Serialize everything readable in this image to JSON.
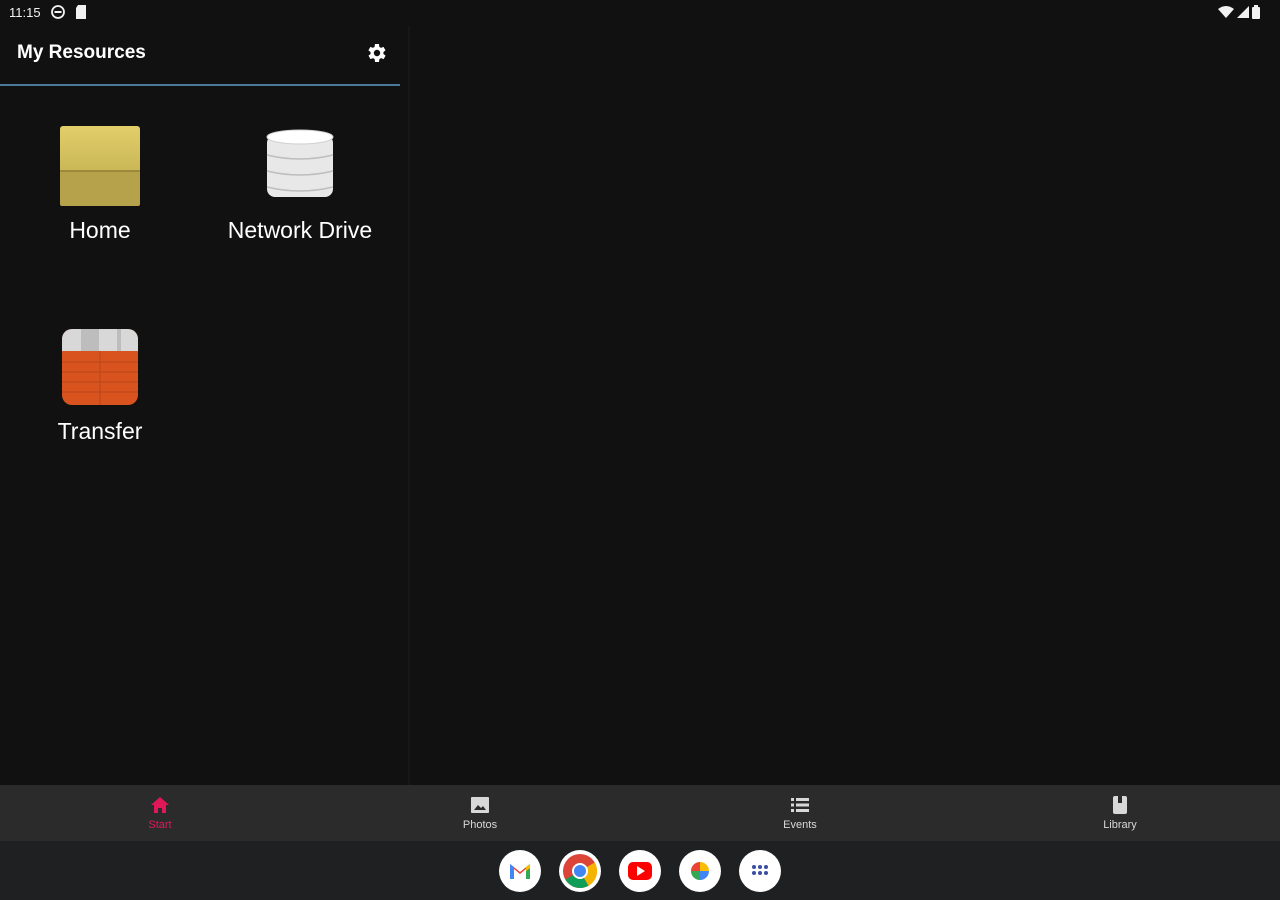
{
  "status_bar": {
    "time": "11:15"
  },
  "panel": {
    "title": "My Resources"
  },
  "resources": [
    {
      "label": "Home",
      "icon": "folder-icon"
    },
    {
      "label": "Network Drive",
      "icon": "database-icon"
    },
    {
      "label": "Transfer",
      "icon": "transfer-box-icon"
    }
  ],
  "bottom_nav": {
    "items": [
      {
        "label": "Start",
        "icon": "home-icon",
        "active": true
      },
      {
        "label": "Photos",
        "icon": "image-icon",
        "active": false
      },
      {
        "label": "Events",
        "icon": "list-icon",
        "active": false
      },
      {
        "label": "Library",
        "icon": "book-icon",
        "active": false
      }
    ]
  },
  "dock": {
    "apps": [
      "gmail-icon",
      "chrome-icon",
      "youtube-icon",
      "photos-icon",
      "app-drawer-icon"
    ]
  },
  "colors": {
    "accent": "#e0185a",
    "header_underline": "#4a7a98",
    "nav_background": "#2b2b2b",
    "background": "#111111"
  }
}
